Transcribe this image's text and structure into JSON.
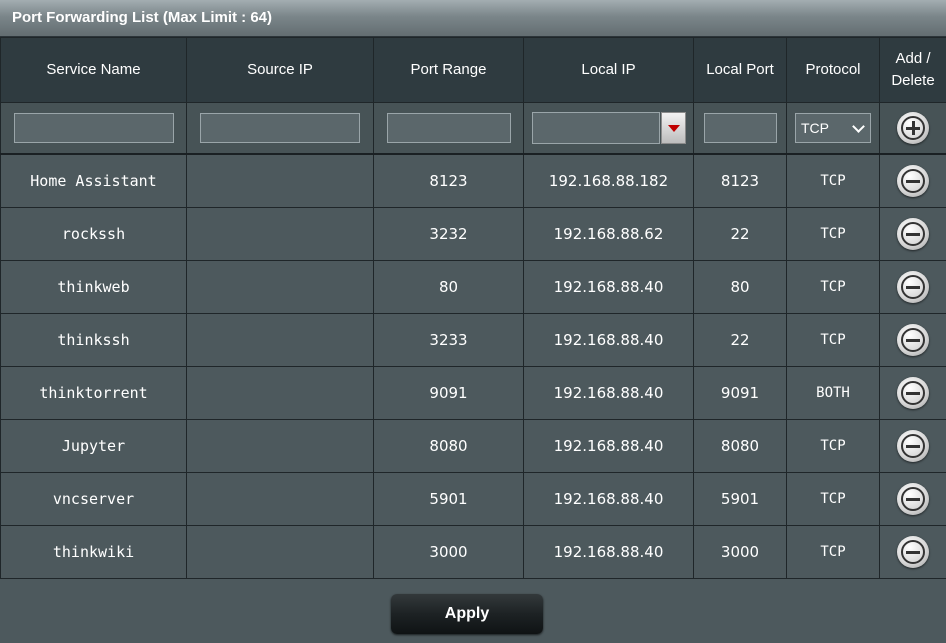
{
  "title": "Port Forwarding List (Max Limit : 64)",
  "columns": {
    "service_name": "Service Name",
    "source_ip": "Source IP",
    "port_range": "Port Range",
    "local_ip": "Local IP",
    "local_port": "Local Port",
    "protocol": "Protocol",
    "add_delete_line1": "Add /",
    "add_delete_line2": "Delete"
  },
  "new_rule": {
    "service_name": "",
    "source_ip": "",
    "port_range": "",
    "local_ip": "",
    "local_port": "",
    "protocol": "TCP"
  },
  "rules": [
    {
      "service_name": "Home Assistant",
      "source_ip": "",
      "port_range": "8123",
      "local_ip": "192.168.88.182",
      "local_port": "8123",
      "protocol": "TCP"
    },
    {
      "service_name": "rockssh",
      "source_ip": "",
      "port_range": "3232",
      "local_ip": "192.168.88.62",
      "local_port": "22",
      "protocol": "TCP"
    },
    {
      "service_name": "thinkweb",
      "source_ip": "",
      "port_range": "80",
      "local_ip": "192.168.88.40",
      "local_port": "80",
      "protocol": "TCP"
    },
    {
      "service_name": "thinkssh",
      "source_ip": "",
      "port_range": "3233",
      "local_ip": "192.168.88.40",
      "local_port": "22",
      "protocol": "TCP"
    },
    {
      "service_name": "thinktorrent",
      "source_ip": "",
      "port_range": "9091",
      "local_ip": "192.168.88.40",
      "local_port": "9091",
      "protocol": "BOTH"
    },
    {
      "service_name": "Jupyter",
      "source_ip": "",
      "port_range": "8080",
      "local_ip": "192.168.88.40",
      "local_port": "8080",
      "protocol": "TCP"
    },
    {
      "service_name": "vncserver",
      "source_ip": "",
      "port_range": "5901",
      "local_ip": "192.168.88.40",
      "local_port": "5901",
      "protocol": "TCP"
    },
    {
      "service_name": "thinkwiki",
      "source_ip": "",
      "port_range": "3000",
      "local_ip": "192.168.88.40",
      "local_port": "3000",
      "protocol": "TCP"
    }
  ],
  "apply_label": "Apply",
  "icons": {
    "add": "add-circle-icon",
    "delete": "remove-circle-icon",
    "dropdown": "dropdown-triangle-icon"
  },
  "colors": {
    "panel_bg": "#4d595d",
    "header_bg": "#2f3b40",
    "dropdown_arrow": "#c00000"
  }
}
